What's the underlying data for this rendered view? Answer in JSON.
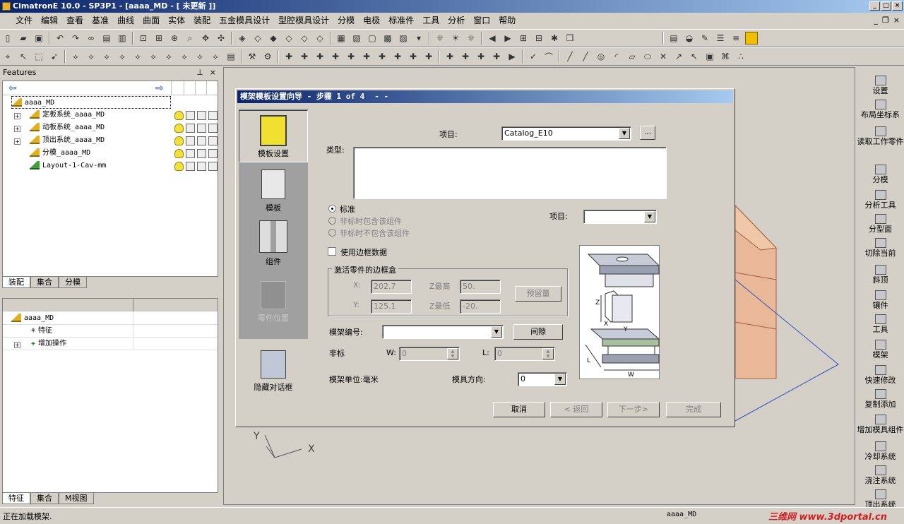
{
  "window": {
    "title": "CimatronE 10.0 - SP3P1 - [aaaa_MD - [ 未更新 ]]"
  },
  "menu": [
    "文件",
    "编辑",
    "查看",
    "基准",
    "曲线",
    "曲面",
    "实体",
    "装配",
    "五金模具设计",
    "型腔模具设计",
    "分模",
    "电极",
    "标准件",
    "工具",
    "分析",
    "窗口",
    "帮助"
  ],
  "features_panel": {
    "header": "Features",
    "tree": [
      {
        "label": "aaaa_MD"
      },
      {
        "label": "定板系统_aaaa_MD"
      },
      {
        "label": "动板系统_aaaa_MD"
      },
      {
        "label": "顶出系统_aaaa_MD"
      },
      {
        "label": "分模_aaaa_MD"
      },
      {
        "label": "Layout-1-Cav-mm"
      }
    ],
    "tabs": [
      "装配",
      "集合",
      "分模"
    ]
  },
  "lower_panel": {
    "tree": [
      {
        "label": "aaaa_MD"
      },
      {
        "label": "特征"
      },
      {
        "label": "增加操作"
      }
    ],
    "tabs": [
      "特征",
      "集合",
      "M视图"
    ]
  },
  "dialog": {
    "title": "模架模板设置向导 - 步骤 1 of 4",
    "side": {
      "item1": "模板设置",
      "item2": "模板",
      "item3": "组件",
      "item4": "零件位置",
      "hide": "隐藏对话框"
    },
    "project_label": "项目:",
    "project_value": "Catalog_E10",
    "browse": "...",
    "type_label": "类型:",
    "radio_standard": "标准",
    "radio_nonstd_incl": "非标时包含该组件",
    "radio_nonstd_excl": "非标时不包含该组件",
    "project2_label": "项目:",
    "project2_value": "",
    "use_bbox": "使用边框数据",
    "group_title": "激活零件的边框盒",
    "x_label": "X:",
    "x_value": "202.7",
    "y_label": "Y:",
    "y_value": "125.1",
    "zmax_label": "Z最高",
    "zmax_value": "50.",
    "zmin_label": "Z最低",
    "zmin_value": "-20.",
    "reserve_btn": "预留量",
    "mold_no_label": "模架编号:",
    "mold_no_value": "",
    "gap_btn": "间隙",
    "nonstd_label": "非标",
    "w_label": "W:",
    "w_value": "0",
    "l_label": "L:",
    "l_value": "0",
    "unit_label": "模架单位:毫米",
    "direction_label": "模具方向:",
    "direction_value": "0",
    "buttons": {
      "cancel": "取消",
      "back": "< 返回",
      "next": "下一步>",
      "finish": "完成"
    },
    "diagram": {
      "z": "Z",
      "x": "X",
      "y": "Y",
      "l": "L",
      "w": "W"
    }
  },
  "axis": {
    "x": "X",
    "y": "Y"
  },
  "right_toolbar": [
    "设置",
    "布局坐标系",
    "读取工作零件",
    "分模",
    "分析工具",
    "分型面",
    "切除当前",
    "斜顶",
    "镶件",
    "工具",
    "模架",
    "快速修改",
    "复制添加",
    "增加模具组件",
    "冷却系统",
    "浇注系统",
    "顶出系统"
  ],
  "status": {
    "text": "正在加载模架.",
    "model": "aaaa_MD",
    "watermark": "三维网 www.3dportal.cn"
  }
}
